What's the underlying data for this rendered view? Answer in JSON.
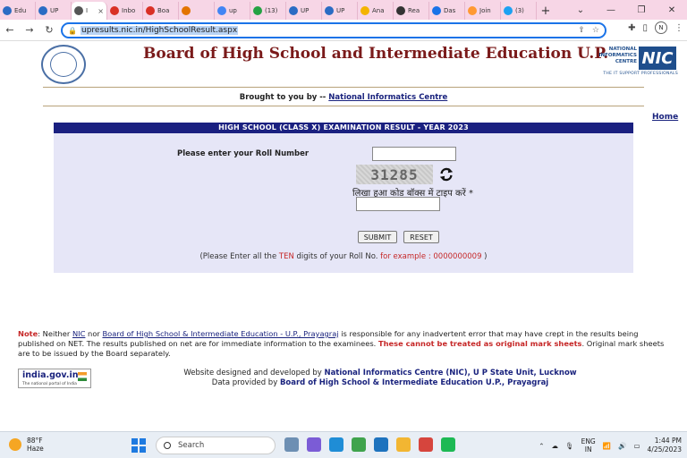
{
  "browser": {
    "tabs": [
      {
        "label": "Edu",
        "color": "#2b6cc4"
      },
      {
        "label": "UP",
        "color": "#2b6cc4"
      },
      {
        "label": "I",
        "color": "#555555",
        "active": true
      },
      {
        "label": "Inbo",
        "color": "#d93025"
      },
      {
        "label": "Boa",
        "color": "#d93025"
      },
      {
        "label": "",
        "color": "#e37400"
      },
      {
        "label": "up",
        "color": "#4285f4"
      },
      {
        "label": "(13)",
        "color": "#25a244"
      },
      {
        "label": "UP",
        "color": "#2b6cc4"
      },
      {
        "label": "UP",
        "color": "#2b6cc4"
      },
      {
        "label": "Ana",
        "color": "#f4b400"
      },
      {
        "label": "Rea",
        "color": "#333333"
      },
      {
        "label": "Das",
        "color": "#1a73e8"
      },
      {
        "label": "Join",
        "color": "#ff9933"
      },
      {
        "label": "(3)",
        "color": "#1da1f2"
      }
    ],
    "new_tab": "+",
    "window_controls": [
      "⌄",
      "—",
      "❐",
      "✕"
    ],
    "nav": {
      "back": "←",
      "forward": "→",
      "reload": "↻"
    },
    "url": "upresults.nic.in/HighSchoolResult.aspx",
    "profile_initial": "N"
  },
  "page": {
    "title": "Board of High School and Intermediate Education U.P.",
    "nic_logo": {
      "line1": "NATIONAL",
      "line2": "INFORMATICS",
      "line3": "CENTRE",
      "mark": "NIC",
      "tagline": "THE IT SUPPORT PROFESSIONALS"
    },
    "brought_prefix": "Brought to you by -- ",
    "brought_link": "National Informatics Centre",
    "home": "Home",
    "form": {
      "header": "HIGH SCHOOL (CLASS X)  EXAMINATION RESULT - YEAR 2023",
      "roll_label": "Please enter your Roll Number",
      "roll_value": "",
      "captcha_code": "31285",
      "captcha_label": "लिखा हुआ कोड बॉक्स में टाइप करें *",
      "captcha_value": "",
      "submit": "SUBMIT",
      "reset": "RESET",
      "hint_prefix": "(Please Enter all the ",
      "hint_ten": "TEN",
      "hint_middle": " digits of your Roll No. ",
      "hint_example": "for example : 0000000009",
      "hint_suffix": " )"
    },
    "note": {
      "heading": "Note",
      "colon": ": Neither ",
      "nic": "NIC",
      "nor": " nor ",
      "board_link": "Board of High School & Intermediate Education - U.P., Prayagraj",
      "body1": " is responsible for any inadvertent error that may have crept in the results being published on NET. The results published on net are for immediate information to the examinees. ",
      "warning": "These cannot be treated as original mark sheets",
      "body2": ". Original mark sheets are to be issued by the Board separately."
    },
    "indiagov": {
      "name": "india.gov.in",
      "tagline": "The national portal of India"
    },
    "footer": {
      "line1_prefix": "Website designed and developed by ",
      "line1_bold": "National Informatics Centre (NIC), U P State Unit, Lucknow",
      "line2_prefix": "Data provided by ",
      "line2_bold": "Board of High School & Intermediate Education U.P., Prayagraj"
    }
  },
  "taskbar": {
    "temp": "88°F",
    "weather": "Haze",
    "search": "Search",
    "lang1": "ENG",
    "lang2": "IN",
    "time": "1:44 PM",
    "date": "4/25/2023",
    "apps": [
      "#6d8fb3",
      "#7b5cd6",
      "#1f8dd6",
      "#3fa34d",
      "#1e73be",
      "#f2b632",
      "#d6453d",
      "#1db954"
    ]
  }
}
